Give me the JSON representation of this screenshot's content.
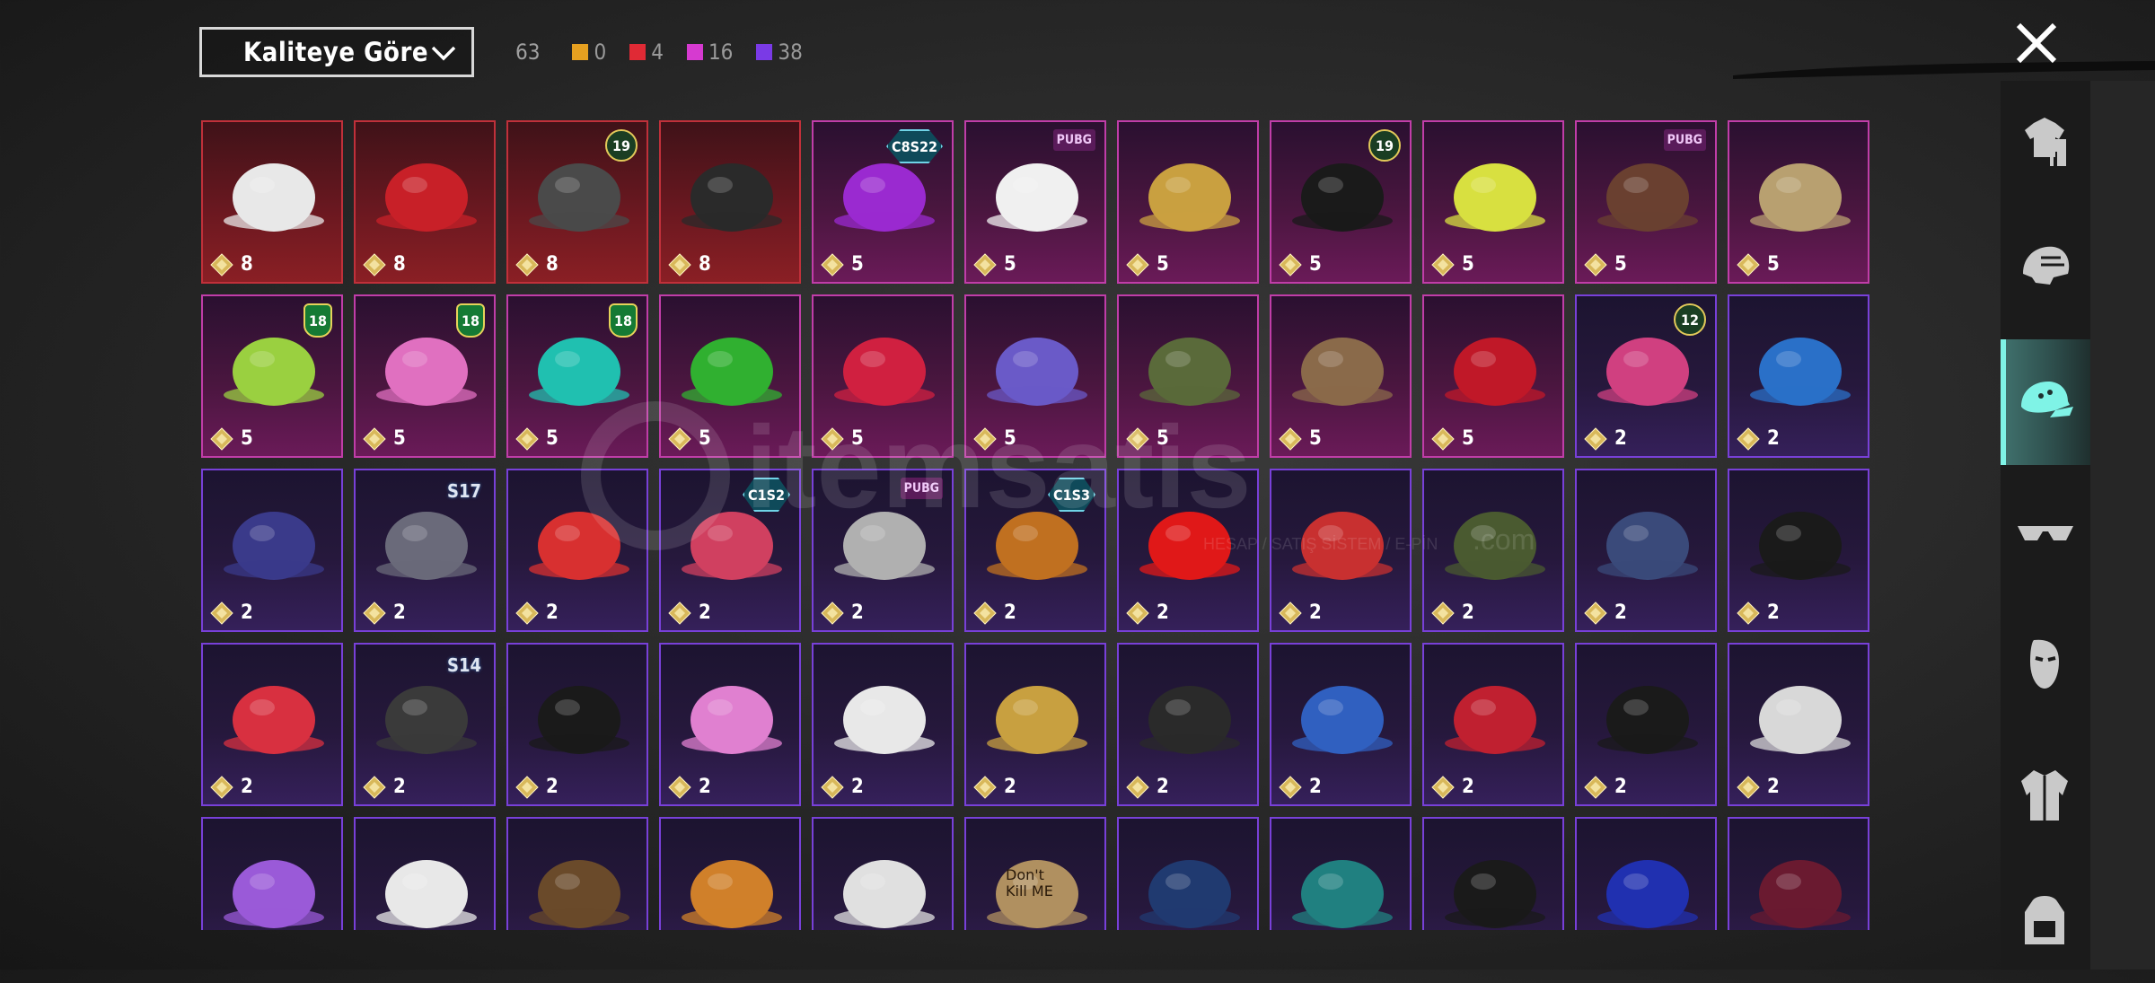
{
  "sort": {
    "label": "Kaliteye Göre"
  },
  "counts": {
    "total": "63",
    "quality": [
      {
        "color": "#e6a020",
        "value": "0"
      },
      {
        "color": "#e02a35",
        "value": "4"
      },
      {
        "color": "#d63ad0",
        "value": "16"
      },
      {
        "color": "#7a3ae6",
        "value": "38"
      }
    ]
  },
  "sidebar": {
    "tabs": [
      {
        "icon": "outfit-icon",
        "selected": false
      },
      {
        "icon": "helmet-icon",
        "selected": false
      },
      {
        "icon": "hat-icon",
        "selected": true
      },
      {
        "icon": "glasses-icon",
        "selected": false
      },
      {
        "icon": "mask-icon",
        "selected": false
      },
      {
        "icon": "jacket-icon",
        "selected": false
      },
      {
        "icon": "backpack-icon",
        "selected": false
      }
    ]
  },
  "watermark": {
    "brand": "itemsatis",
    "tagline": "HESAP / SATIŞ SİSTEM / E-PİN",
    "suffix": ".com"
  },
  "items": [
    {
      "quality": "red",
      "cost": "8",
      "icon": "cowboy-hat-icon",
      "badge": null
    },
    {
      "quality": "red",
      "cost": "8",
      "icon": "red-helmet-icon",
      "badge": null
    },
    {
      "quality": "red",
      "cost": "8",
      "icon": "dark-helmet-icon",
      "badge": {
        "type": "gold",
        "text": "19"
      }
    },
    {
      "quality": "red",
      "cost": "8",
      "icon": "tricorn-hat-icon",
      "badge": null
    },
    {
      "quality": "pink",
      "cost": "5",
      "icon": "purple-hair-icon",
      "badge": {
        "type": "hex",
        "text": "C8S22"
      }
    },
    {
      "quality": "pink",
      "cost": "5",
      "icon": "panda-mask-icon",
      "badge": {
        "type": "pink",
        "text": "PUBG"
      }
    },
    {
      "quality": "pink",
      "cost": "5",
      "icon": "gold-horned-helmet-icon",
      "badge": null
    },
    {
      "quality": "pink",
      "cost": "5",
      "icon": "black-hair-icon",
      "badge": {
        "type": "gold",
        "text": "19"
      }
    },
    {
      "quality": "pink",
      "cost": "5",
      "icon": "yellow-bucket-hat-icon",
      "badge": null
    },
    {
      "quality": "pink",
      "cost": "5",
      "icon": "gas-mask-icon",
      "badge": {
        "type": "pink",
        "text": "PUBG"
      }
    },
    {
      "quality": "pink",
      "cost": "5",
      "icon": "gold-pith-helmet-icon",
      "badge": null
    },
    {
      "quality": "pink",
      "cost": "5",
      "icon": "green-tentacle-hat-icon",
      "badge": {
        "type": "shield",
        "text": "18"
      }
    },
    {
      "quality": "pink",
      "cost": "5",
      "icon": "pink-cap-headphones-icon",
      "badge": {
        "type": "shield",
        "text": "18"
      }
    },
    {
      "quality": "pink",
      "cost": "5",
      "icon": "cap-headphones-icon",
      "badge": {
        "type": "shield",
        "text": "18"
      }
    },
    {
      "quality": "pink",
      "cost": "5",
      "icon": "frog-hat-icon",
      "badge": null
    },
    {
      "quality": "pink",
      "cost": "5",
      "icon": "red-hair-cap-icon",
      "badge": null
    },
    {
      "quality": "pink",
      "cost": "5",
      "icon": "holo-cap-icon",
      "badge": null
    },
    {
      "quality": "pink",
      "cost": "5",
      "icon": "military-helmet-icon",
      "badge": null
    },
    {
      "quality": "pink",
      "cost": "5",
      "icon": "antler-headband-icon",
      "badge": null
    },
    {
      "quality": "pink",
      "cost": "5",
      "icon": "devil-horns-icon",
      "badge": null
    },
    {
      "quality": "purple",
      "cost": "2",
      "icon": "bunny-ears-helmet-icon",
      "badge": {
        "type": "gold",
        "text": "12"
      }
    },
    {
      "quality": "purple",
      "cost": "2",
      "icon": "blue-cap-icon",
      "badge": null
    },
    {
      "quality": "purple",
      "cost": "2",
      "icon": "tactical-hood-icon",
      "badge": null
    },
    {
      "quality": "purple",
      "cost": "2",
      "icon": "knight-helmet-icon",
      "badge": {
        "type": "season",
        "text": "S17"
      }
    },
    {
      "quality": "purple",
      "cost": "2",
      "icon": "red-fez-icon",
      "badge": null
    },
    {
      "quality": "purple",
      "cost": "2",
      "icon": "striped-cap-icon",
      "badge": {
        "type": "hex",
        "text": "C1S2"
      }
    },
    {
      "quality": "purple",
      "cost": "2",
      "icon": "grey-hair-icon",
      "badge": {
        "type": "pink",
        "text": "PUBG"
      }
    },
    {
      "quality": "purple",
      "cost": "2",
      "icon": "rocket-helmet-icon",
      "badge": {
        "type": "hex",
        "text": "C1S3"
      }
    },
    {
      "quality": "purple",
      "cost": "2",
      "icon": "red-mohawk-icon",
      "badge": null
    },
    {
      "quality": "purple",
      "cost": "2",
      "icon": "motorbike-helmet-icon",
      "badge": null
    },
    {
      "quality": "purple",
      "cost": "2",
      "icon": "army-cap-icon",
      "badge": null
    },
    {
      "quality": "purple",
      "cost": "2",
      "icon": "navy-cap-icon",
      "badge": null
    },
    {
      "quality": "purple",
      "cost": "2",
      "icon": "black-fedora-icon",
      "badge": null
    },
    {
      "quality": "purple",
      "cost": "2",
      "icon": "mushroom-hat-icon",
      "badge": null
    },
    {
      "quality": "purple",
      "cost": "2",
      "icon": "spartan-helmet-icon",
      "badge": {
        "type": "season",
        "text": "S14"
      }
    },
    {
      "quality": "purple",
      "cost": "2",
      "icon": "pink-cap-icon",
      "badge": null
    },
    {
      "quality": "purple",
      "cost": "2",
      "icon": "cat-headphones-pink-icon",
      "badge": null
    },
    {
      "quality": "purple",
      "cost": "2",
      "icon": "cat-headphones-white-icon",
      "badge": null
    },
    {
      "quality": "purple",
      "cost": "2",
      "icon": "carnival-mask-icon",
      "badge": null
    },
    {
      "quality": "purple",
      "cost": "2",
      "icon": "black-mask-icon",
      "badge": null
    },
    {
      "quality": "purple",
      "cost": "2",
      "icon": "shark-hat-icon",
      "badge": null
    },
    {
      "quality": "purple",
      "cost": "2",
      "icon": "red-beret-icon",
      "badge": null
    },
    {
      "quality": "purple",
      "cost": "2",
      "icon": "black-bowler-icon",
      "badge": null
    },
    {
      "quality": "purple",
      "cost": "2",
      "icon": "white-shark-hat-icon",
      "badge": null
    },
    {
      "quality": "purple",
      "cost": "",
      "icon": "flower-crown-icon",
      "badge": null
    },
    {
      "quality": "purple",
      "cost": "",
      "icon": "maid-headband-icon",
      "badge": null
    },
    {
      "quality": "purple",
      "cost": "",
      "icon": "cupcake-hat-icon",
      "badge": null
    },
    {
      "quality": "purple",
      "cost": "",
      "icon": "burger-hat-icon",
      "badge": null
    },
    {
      "quality": "purple",
      "cost": "",
      "icon": "head-mirror-icon",
      "badge": null
    },
    {
      "quality": "purple",
      "cost": "",
      "icon": "cardboard-box-icon",
      "badge": null,
      "label": "Don't Kill ME"
    },
    {
      "quality": "purple",
      "cost": "",
      "icon": "blue-beanie-icon",
      "badge": null
    },
    {
      "quality": "purple",
      "cost": "",
      "icon": "teal-beanie-icon",
      "badge": null
    },
    {
      "quality": "purple",
      "cost": "",
      "icon": "black-gold-cap-icon",
      "badge": null
    },
    {
      "quality": "purple",
      "cost": "",
      "icon": "blue-baseball-cap-icon",
      "badge": null
    },
    {
      "quality": "purple",
      "cost": "",
      "icon": "maroon-fedora-icon",
      "badge": null
    }
  ]
}
